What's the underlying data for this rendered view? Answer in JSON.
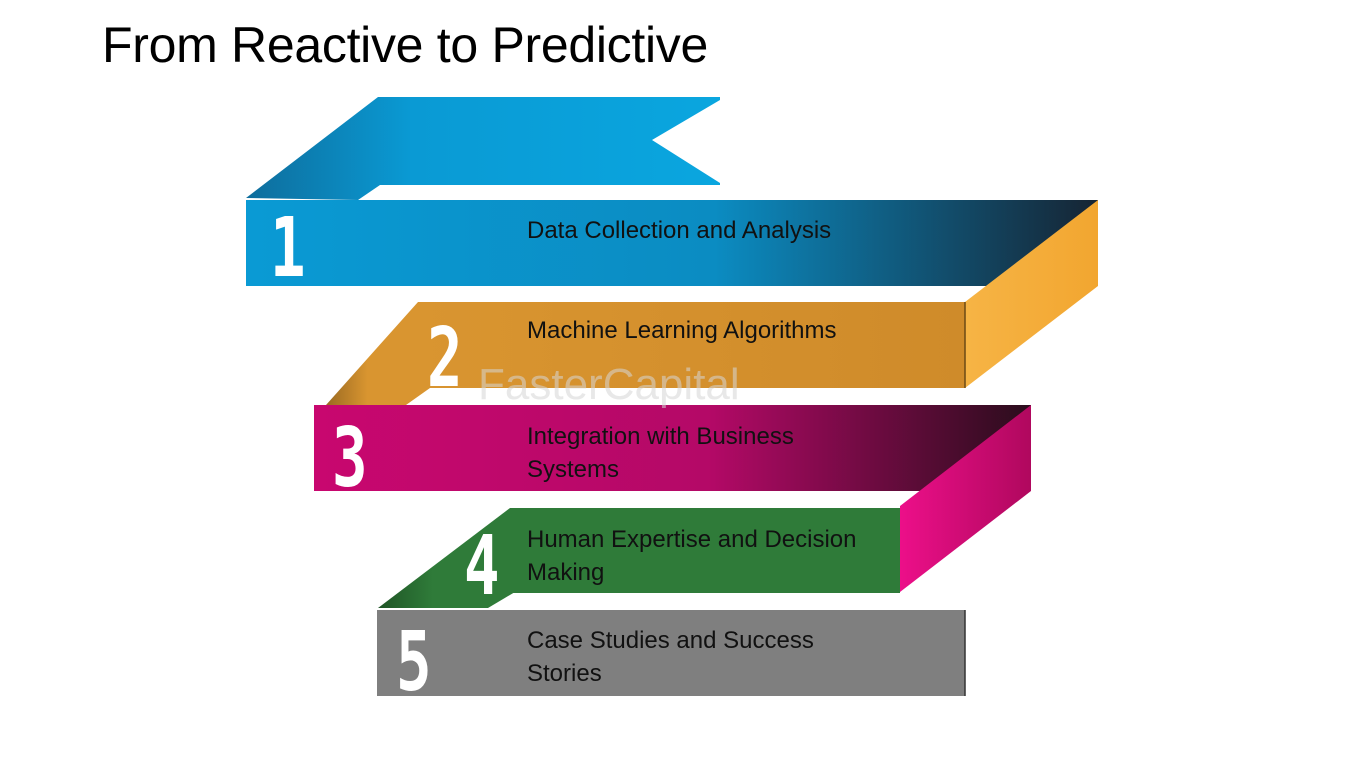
{
  "title": "From Reactive to Predictive",
  "watermark": "FasterCapital",
  "steps": [
    {
      "number": "1",
      "label": "Data Collection and Analysis",
      "color": "#0a9ad4"
    },
    {
      "number": "2",
      "label": "Machine Learning Algorithms",
      "color": "#d99530"
    },
    {
      "number": "3",
      "label": "Integration with Business Systems",
      "color": "#c8076f"
    },
    {
      "number": "4",
      "label": "Human Expertise and Decision Making",
      "color": "#2f7b39"
    },
    {
      "number": "5",
      "label": "Case Studies and Success Stories",
      "color": "#7f7f7f"
    }
  ]
}
